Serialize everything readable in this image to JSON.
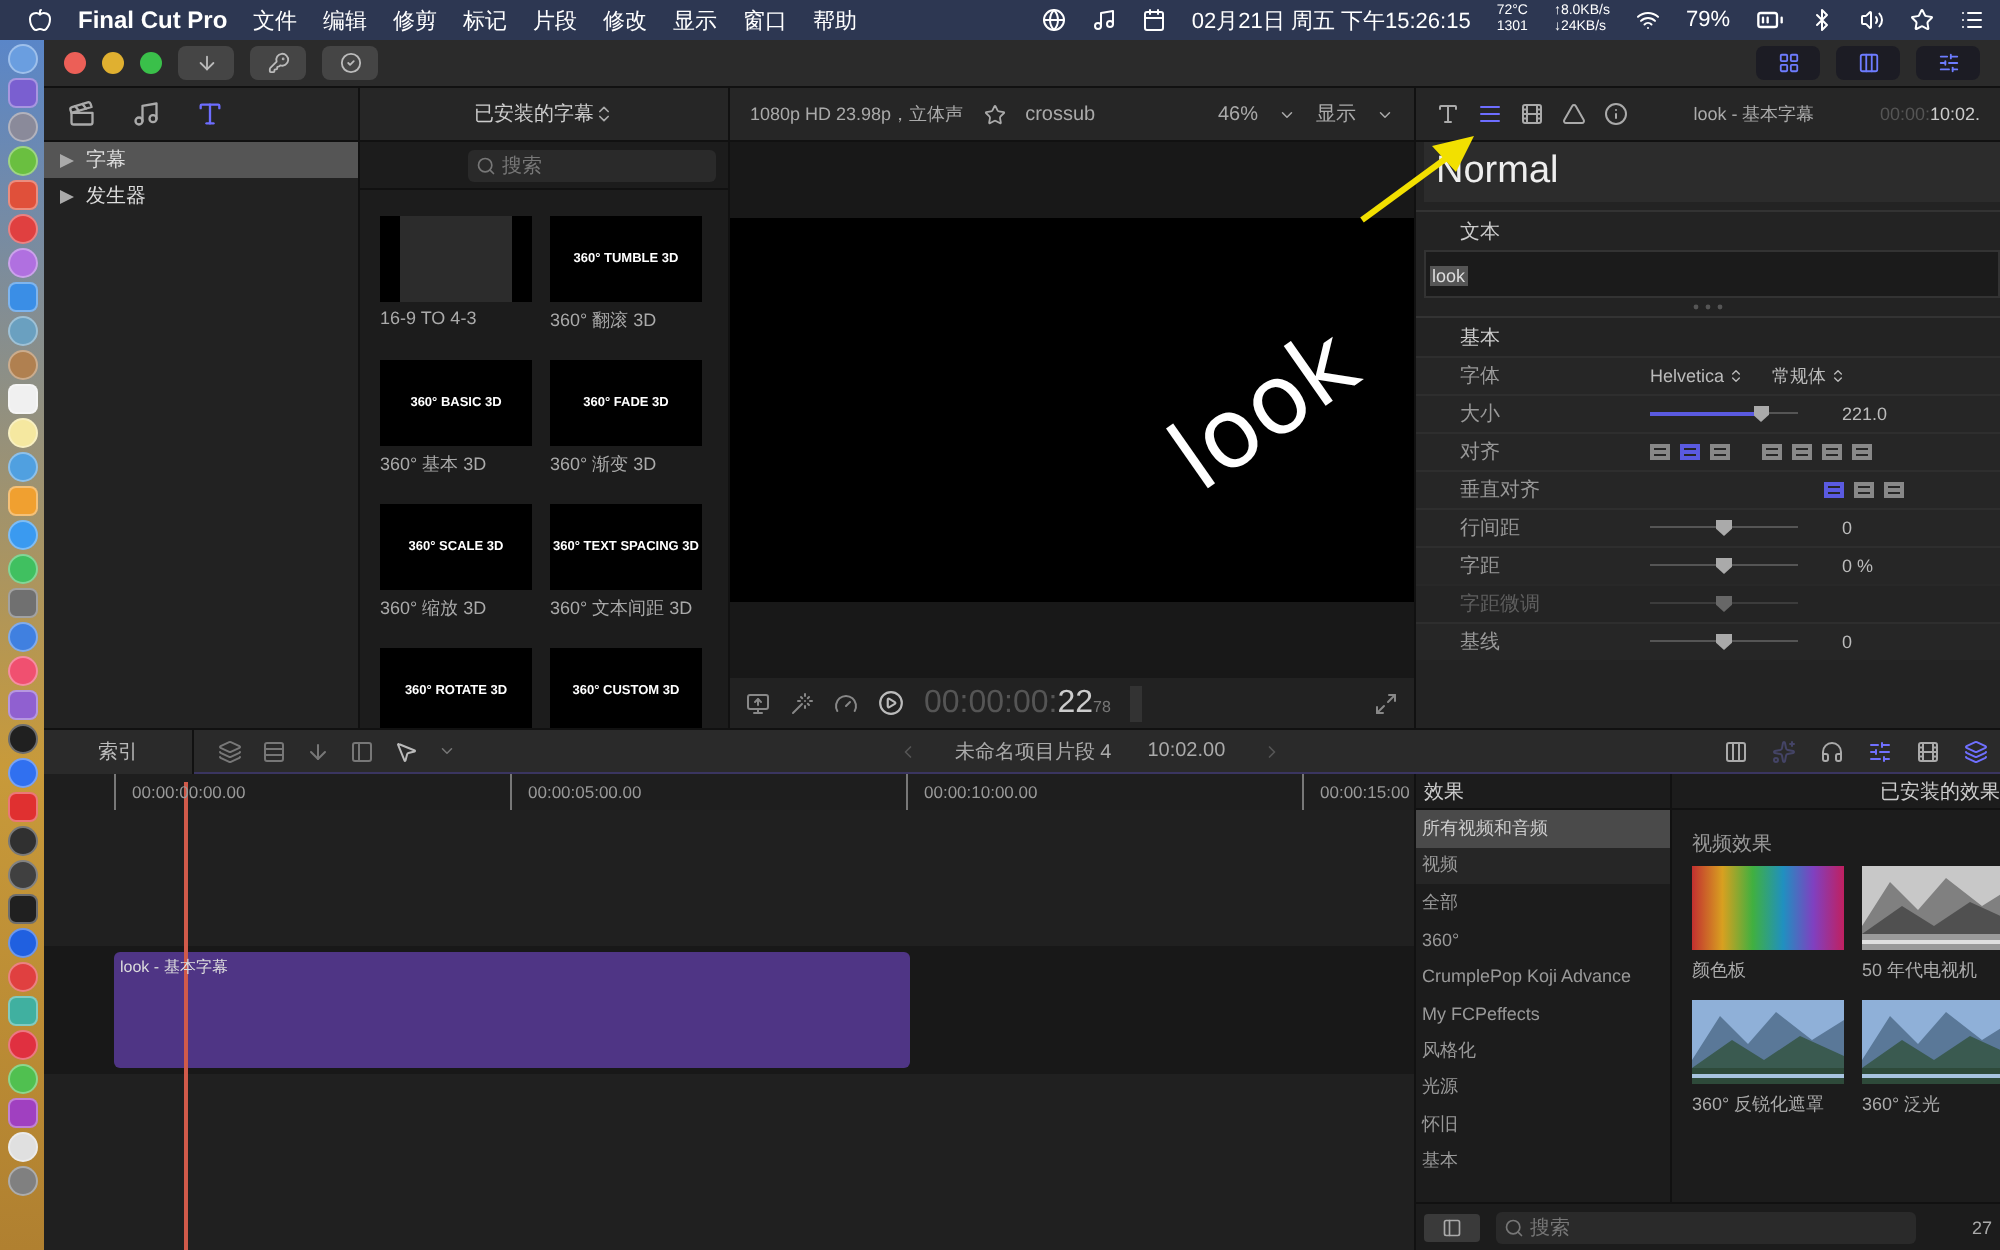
{
  "menu_bar": {
    "app": "Final Cut Pro",
    "menus": [
      "文件",
      "编辑",
      "修剪",
      "标记",
      "片段",
      "修改",
      "显示",
      "窗口",
      "帮助"
    ],
    "datetime": "02月21日 周五 下午15:26:15",
    "temperature": "72°C",
    "fan": "1301",
    "upload": "↑8.0KB/s",
    "download": "↓24KB/s",
    "battery": "79%"
  },
  "browser": {
    "tabs": [
      {
        "selected": false
      },
      {
        "selected": false
      },
      {
        "selected": true
      }
    ],
    "sidebar": [
      {
        "label": "字幕",
        "selected": true
      },
      {
        "label": "发生器",
        "selected": false
      }
    ],
    "title": "已安装的字幕",
    "search": {
      "placeholder": "搜索"
    },
    "tiles": [
      {
        "kind": "letterbox",
        "label": "16-9 TO 4-3"
      },
      {
        "kind": "title",
        "thumb": "360° TUMBLE 3D",
        "label": "360° 翻滚 3D"
      },
      {
        "kind": "title",
        "thumb": "360° BASIC 3D",
        "label": "360° 基本 3D"
      },
      {
        "kind": "title",
        "thumb": "360° FADE 3D",
        "label": "360° 渐变 3D"
      },
      {
        "kind": "title",
        "thumb": "360° SCALE 3D",
        "label": "360° 缩放 3D"
      },
      {
        "kind": "title",
        "thumb": "360° TEXT SPACING 3D",
        "label": "360° 文本间距 3D"
      },
      {
        "kind": "title",
        "thumb": "360° ROTATE 3D"
      },
      {
        "kind": "title",
        "thumb": "360° CUSTOM 3D"
      }
    ]
  },
  "viewer": {
    "format": "1080p HD 23.98p，立体声",
    "clip": "crossub",
    "zoom": "46%",
    "view": "显示",
    "frame_text": "look",
    "timecode_dim": "00:00:00:",
    "timecode": "22",
    "timecode_sub": "78"
  },
  "inspector": {
    "tabs": [
      {
        "selected": false
      },
      {
        "selected": true
      },
      {
        "selected": false
      },
      {
        "selected": false
      },
      {
        "selected": false
      }
    ],
    "title": "look - 基本字幕",
    "time_dim": "00:00:",
    "time": "10:02.",
    "preset": "Normal",
    "text_section": "文本",
    "text_value": "look",
    "basic_section": "基本",
    "rows": [
      {
        "kind": "popup",
        "label": "字体",
        "disabled": false,
        "values": [
          "Helvetica",
          "常规体"
        ]
      },
      {
        "kind": "slider",
        "label": "大小",
        "disabled": false,
        "level": 0.75,
        "filled": true,
        "value": "221.0"
      },
      {
        "kind": "align",
        "label": "对齐",
        "disabled": false,
        "options": [
          {
            "selected": false
          },
          {
            "selected": true
          },
          {
            "selected": false
          },
          {
            "selected": false
          },
          {
            "selected": false
          },
          {
            "selected": false
          },
          {
            "selected": false
          }
        ]
      },
      {
        "kind": "valign",
        "label": "垂直对齐",
        "disabled": false,
        "options": [
          {
            "selected": true
          },
          {
            "selected": false
          },
          {
            "selected": false
          }
        ]
      },
      {
        "kind": "slider",
        "label": "行间距",
        "disabled": false,
        "level": 0.5,
        "filled": false,
        "value": "0"
      },
      {
        "kind": "slider",
        "label": "字距",
        "disabled": false,
        "level": 0.5,
        "filled": false,
        "value": "0 %"
      },
      {
        "kind": "slider",
        "label": "字距微调",
        "disabled": true,
        "level": 0.5,
        "filled": false
      },
      {
        "kind": "slider",
        "label": "基线",
        "disabled": false,
        "level": 0.5,
        "filled": false,
        "value": "0"
      }
    ]
  },
  "timeline": {
    "index_label": "索引",
    "project": "未命名项目片段 4",
    "duration": "10:02.00",
    "ruler": [
      "00:00:00:00.00",
      "00:00:05:00.00",
      "00:00:10:00.00",
      "00:00:15:00"
    ],
    "clip": {
      "label": "look - 基本字幕"
    }
  },
  "effects": {
    "header": "效果",
    "title": "已安装的效果",
    "categories": [
      {
        "kind": "item",
        "label": "所有视频和音频",
        "selected": true
      },
      {
        "kind": "group",
        "label": "视频",
        "selected": false
      },
      {
        "kind": "item",
        "label": "全部",
        "selected": false
      },
      {
        "kind": "item",
        "label": "360°",
        "selected": false
      },
      {
        "kind": "item",
        "label": "CrumplePop Koji Advance",
        "selected": false
      },
      {
        "kind": "item",
        "label": "My FCPeffects",
        "selected": false
      },
      {
        "kind": "item",
        "label": "风格化",
        "selected": false
      },
      {
        "kind": "item",
        "label": "光源",
        "selected": false
      },
      {
        "kind": "item",
        "label": "怀旧",
        "selected": false
      },
      {
        "kind": "item",
        "label": "基本",
        "selected": false
      }
    ],
    "section": "视频效果",
    "items": [
      {
        "kind": "gradient",
        "label": "颜色板"
      },
      {
        "kind": "picture",
        "mono": true,
        "label": "50 年代电视机"
      },
      {
        "kind": "picture",
        "mono": false,
        "label": "360° 反锐化遮罩"
      },
      {
        "kind": "picture",
        "mono": false,
        "label": "360° 泛光"
      }
    ],
    "search": {
      "placeholder": "搜索"
    },
    "count": "27"
  }
}
